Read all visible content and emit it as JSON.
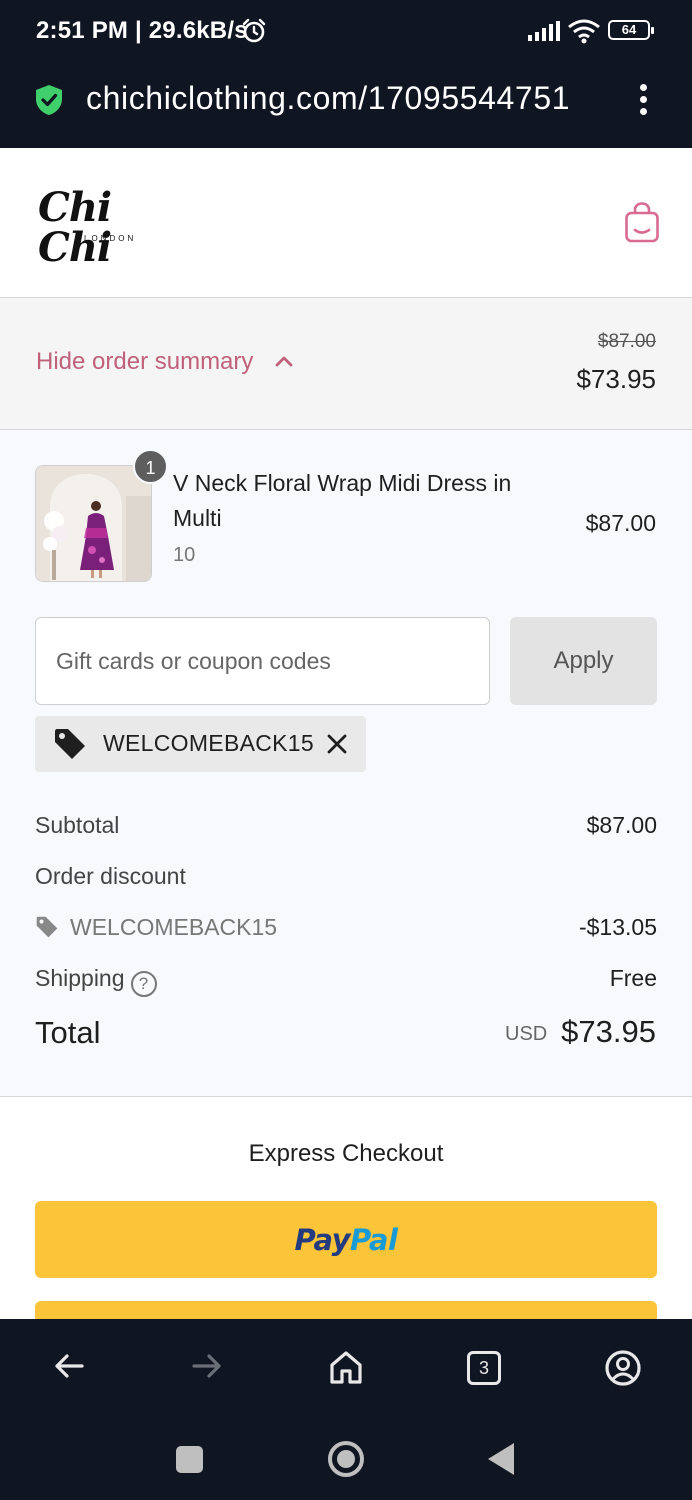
{
  "status_bar": {
    "time": "2:51 PM | 29.6kB/s",
    "battery": "64"
  },
  "browser": {
    "url": "chichiclothing.com/17095544751",
    "tab_count": "3"
  },
  "store": {
    "logo_text": "Chi Chi",
    "logo_subtext": "LONDON"
  },
  "summary_toggle": {
    "label": "Hide order summary",
    "original_price": "$87.00",
    "price": "$73.95"
  },
  "line_item": {
    "quantity": "1",
    "title": "V Neck Floral Wrap Midi Dress in Multi",
    "variant": "10",
    "price": "$87.00"
  },
  "coupon": {
    "placeholder": "Gift cards or coupon codes",
    "value": "",
    "apply_label": "Apply",
    "applied_code": "WELCOMEBACK15"
  },
  "totals": {
    "subtotal_label": "Subtotal",
    "subtotal_value": "$87.00",
    "discount_label": "Order discount",
    "discount_code": "WELCOMEBACK15",
    "discount_value": "-$13.05",
    "shipping_label": "Shipping",
    "shipping_help": "?",
    "shipping_value": "Free",
    "total_label": "Total",
    "total_currency": "USD",
    "total_value": "$73.95"
  },
  "express": {
    "title": "Express Checkout",
    "paypal_part1": "Pay",
    "paypal_part2": "Pal"
  },
  "colors": {
    "accent_pink": "#c0607a",
    "paypal_yellow": "#fcc439",
    "dark_bar": "#0f1521",
    "secure_green": "#3fcf6b"
  }
}
